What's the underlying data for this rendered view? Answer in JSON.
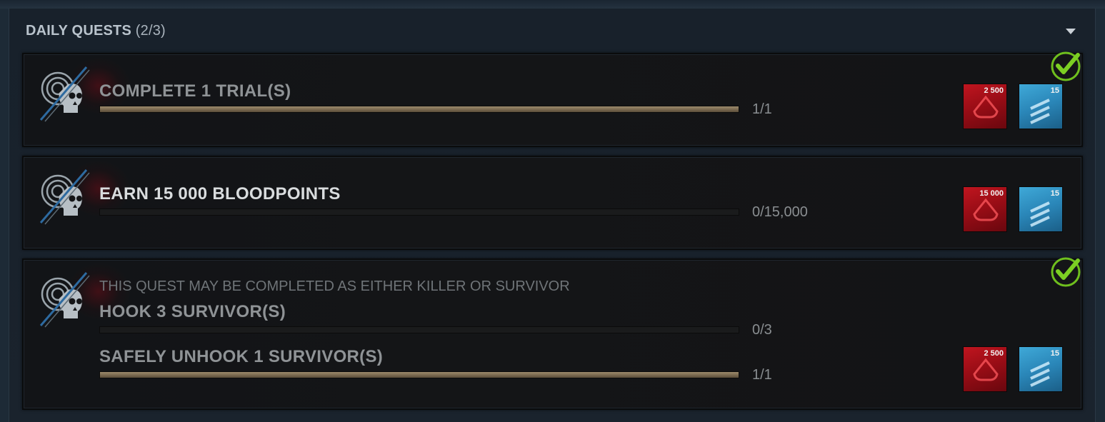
{
  "panel": {
    "title": "DAILY QUESTS",
    "count": "(2/3)",
    "collapse_icon": "chevron-down-icon"
  },
  "quests": [
    {
      "title": "COMPLETE 1 TRIAL(S)",
      "progress_text": "1/1",
      "progress_fraction": 1.0,
      "completed": true,
      "rewards": [
        {
          "type": "bloodpoints",
          "amount": "2 500"
        },
        {
          "type": "rift-fragments",
          "amount": "15"
        }
      ]
    },
    {
      "title": "EARN 15 000 BLOODPOINTS",
      "progress_text": "0/15,000",
      "progress_fraction": 0.0,
      "completed": false,
      "rewards": [
        {
          "type": "bloodpoints",
          "amount": "15 000"
        },
        {
          "type": "rift-fragments",
          "amount": "15"
        }
      ]
    },
    {
      "note": "THIS QUEST MAY BE COMPLETED AS EITHER KILLER OR SURVIVOR",
      "completed": true,
      "objectives": [
        {
          "title": "HOOK 3 SURVIVOR(S)",
          "progress_text": "0/3",
          "progress_fraction": 0.0
        },
        {
          "title": "SAFELY UNHOOK 1 SURVIVOR(S)",
          "progress_text": "1/1",
          "progress_fraction": 1.0
        }
      ],
      "rewards": [
        {
          "type": "bloodpoints",
          "amount": "2 500"
        },
        {
          "type": "rift-fragments",
          "amount": "15"
        }
      ]
    }
  ],
  "colors": {
    "check": "#6fbf1e",
    "bloodpoints": "#b3121c",
    "rift": "#3a9fd0",
    "progress_fill": "#8c7b5e"
  }
}
